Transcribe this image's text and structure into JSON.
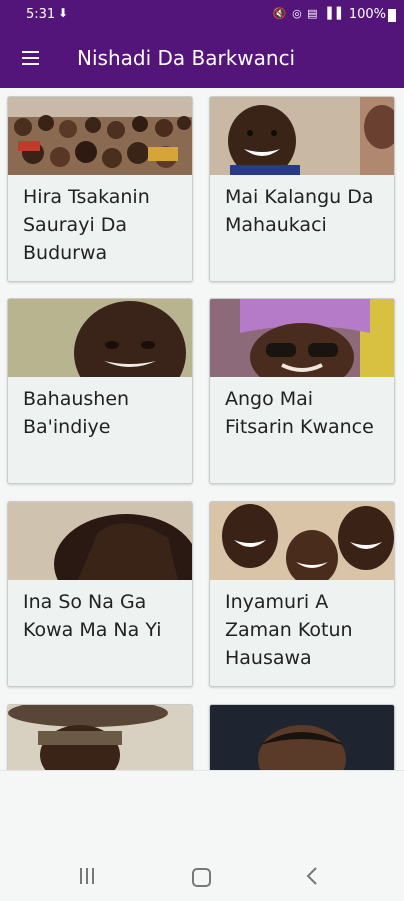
{
  "status_bar": {
    "time": "5:31",
    "battery": "100%"
  },
  "app_bar": {
    "title": "Nishadi Da Barkwanci",
    "background_color": "#54157a"
  },
  "articles": [
    {
      "title": "Hira Tsakanin Saurayi Da Budurwa"
    },
    {
      "title": "Mai Kalangu Da Mahaukaci"
    },
    {
      "title": "Bahaushen Ba'indiye"
    },
    {
      "title": "Ango Mai Fitsarin Kwance"
    },
    {
      "title": "Ina So Na Ga Kowa Ma Na Yi"
    },
    {
      "title": "Inyamuri A Zaman Kotun Hausawa"
    },
    {
      "title": ""
    },
    {
      "title": ""
    }
  ],
  "icons": {
    "menu": "menu-icon",
    "recent_apps": "recent-apps-icon",
    "home": "home-icon",
    "back": "back-icon"
  }
}
